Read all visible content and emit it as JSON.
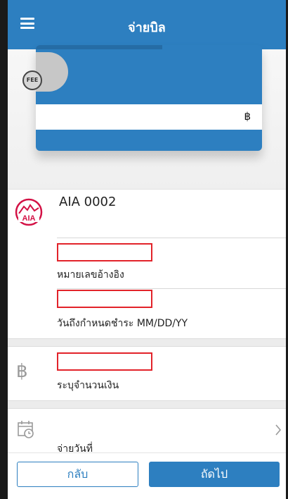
{
  "header": {
    "title": "จ่ายบิล",
    "menu_icon": "hamburger-menu-icon"
  },
  "card": {
    "fee_icon_text": "FEE",
    "currency_symbol": "฿"
  },
  "biller": {
    "name": "AIA 0002",
    "logo_text": "AIA"
  },
  "form": {
    "ref_label": "หมายเลขอ้างอิง",
    "due_label": "วันถึงกำหนดชำระ MM/DD/YY",
    "amount_label": "ระบุจำนวนเงิน",
    "amount_icon": "฿",
    "pay_date_label": "จ่ายวันที่"
  },
  "footer": {
    "back_label": "กลับ",
    "next_label": "ถัดไป"
  },
  "colors": {
    "primary": "#2d7fc0",
    "highlight_box": "#e2232a",
    "aia_red": "#d31145"
  }
}
